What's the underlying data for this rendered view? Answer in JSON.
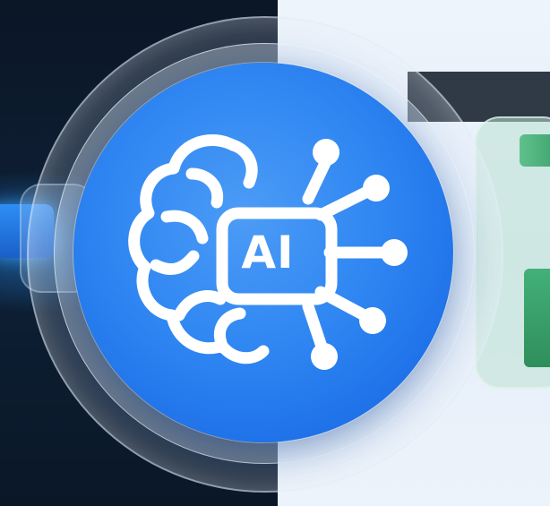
{
  "logo": {
    "text": "AI",
    "icon": "brain-circuit-icon"
  },
  "colors": {
    "disc": "#2f86f2",
    "left_background": "#0e2036",
    "right_background": "#e8f0fa",
    "accent_green": "#3aa06a",
    "glyph": "#ffffff"
  }
}
